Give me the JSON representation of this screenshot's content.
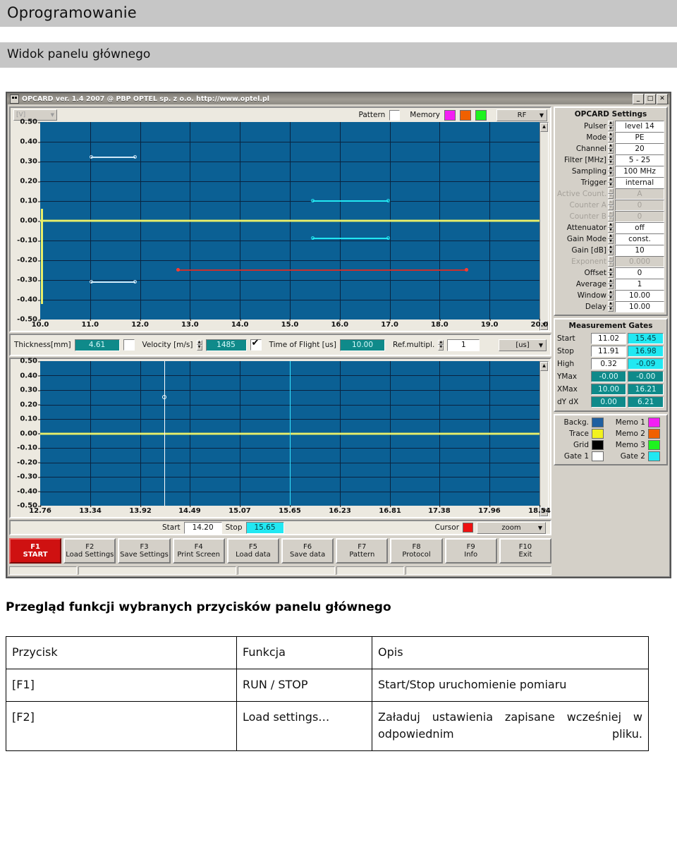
{
  "document": {
    "title": "Oprogramowanie",
    "section": "Widok panelu głównego",
    "overview_title": "Przegląd funkcji wybranych przycisków panelu głównego"
  },
  "app": {
    "titlebar": {
      "title": "OPCARD ver. 1.4 2007 @ PBP OPTEL sp. z o.o. http://www.optel.pl",
      "minimize": "_",
      "maximize": "□",
      "close": "✕"
    },
    "top_chart_bar": {
      "unit_combo": "[V]",
      "pattern_label": "Pattern",
      "memory_label": "Memory",
      "memory_colors": [
        "#f31ef3",
        "#f06000",
        "#1ef31e"
      ],
      "signal_combo": "RF"
    },
    "measure_bar": {
      "thickness_label": "Thickness[mm]",
      "thickness_value": "4.61",
      "velocity_label": "Velocity [m/s]",
      "velocity_value": "1485",
      "tof_label": "Time of Flight [us]",
      "tof_value": "10.00",
      "refmult_label": "Ref.multipl.",
      "refmult_value": "1",
      "unit_combo": "[us]"
    },
    "cursor_bar": {
      "start_label": "Start",
      "start_value": "14.20",
      "stop_label": "Stop",
      "stop_value": "15.65",
      "cursor_label": "Cursor",
      "cursor_color": "#ee1111",
      "mode_combo": "zoom"
    },
    "settings": {
      "title": "OPCARD Settings",
      "rows": [
        {
          "name": "Pulser",
          "value": "level 14",
          "disabled": false
        },
        {
          "name": "Mode",
          "value": "PE",
          "disabled": false
        },
        {
          "name": "Channel",
          "value": "20",
          "disabled": false
        },
        {
          "name": "Filter [MHz]",
          "value": "5 - 25",
          "disabled": false
        },
        {
          "name": "Sampling",
          "value": "100 MHz",
          "disabled": false
        },
        {
          "name": "Trigger",
          "value": "internal",
          "disabled": false
        },
        {
          "name": "Active Count.",
          "value": "A",
          "disabled": true
        },
        {
          "name": "Counter A",
          "value": "0",
          "disabled": true
        },
        {
          "name": "Counter B",
          "value": "0",
          "disabled": true
        },
        {
          "name": "Attenuator",
          "value": "off",
          "disabled": false
        },
        {
          "name": "Gain Mode",
          "value": "const.",
          "disabled": false
        },
        {
          "name": "Gain [dB]",
          "value": "10",
          "disabled": false
        },
        {
          "name": "Exponent",
          "value": "0.000",
          "disabled": true
        },
        {
          "name": "Offset",
          "value": "0",
          "disabled": false
        },
        {
          "name": "Average",
          "value": "1",
          "disabled": false
        },
        {
          "name": "Window",
          "value": "10.00",
          "disabled": false
        },
        {
          "name": "Delay",
          "value": "10.00",
          "disabled": false
        }
      ]
    },
    "gates": {
      "title": "Measurement Gates",
      "rows": [
        {
          "name": "Start",
          "a": "11.02",
          "b": "15.45",
          "a_style": "gw",
          "b_style": "gc"
        },
        {
          "name": "Stop",
          "a": "11.91",
          "b": "16.98",
          "a_style": "gw",
          "b_style": "gc"
        },
        {
          "name": "High",
          "a": "0.32",
          "b": "-0.09",
          "a_style": "gw",
          "b_style": "gc"
        },
        {
          "name": "YMax",
          "a": "-0.00",
          "b": "-0.00",
          "a_style": "gt",
          "b_style": "gt"
        },
        {
          "name": "XMax",
          "a": "10.00",
          "b": "16.21",
          "a_style": "gt",
          "b_style": "gt"
        },
        {
          "name": "dY dX",
          "a": "0.00",
          "b": "6.21",
          "a_style": "gt",
          "b_style": "gt"
        }
      ]
    },
    "legend": {
      "left": [
        {
          "name": "Backg.",
          "color": "#1f5fa0"
        },
        {
          "name": "Trace",
          "color": "#f2f21e"
        },
        {
          "name": "Grid",
          "color": "#000000"
        },
        {
          "name": "Gate 1",
          "color": "#ffffff"
        }
      ],
      "right": [
        {
          "name": "Memo 1",
          "color": "#f31ef3"
        },
        {
          "name": "Memo 2",
          "color": "#f06000"
        },
        {
          "name": "Memo 3",
          "color": "#1ef31e"
        },
        {
          "name": "Gate 2",
          "color": "#22e8f2"
        }
      ]
    },
    "fkeys": [
      {
        "key": "F1",
        "label": "START",
        "accent": "#cf1111"
      },
      {
        "key": "F2",
        "label": "Load Settings",
        "accent": ""
      },
      {
        "key": "F3",
        "label": "Save Settings",
        "accent": ""
      },
      {
        "key": "F4",
        "label": "Print Screen",
        "accent": ""
      },
      {
        "key": "F5",
        "label": "Load data",
        "accent": ""
      },
      {
        "key": "F6",
        "label": "Save data",
        "accent": ""
      },
      {
        "key": "F7",
        "label": "Pattern",
        "accent": ""
      },
      {
        "key": "F8",
        "label": "Protocol",
        "accent": ""
      },
      {
        "key": "F9",
        "label": "Info",
        "accent": ""
      },
      {
        "key": "F10",
        "label": "Exit",
        "accent": ""
      }
    ]
  },
  "chart_data": [
    {
      "type": "line",
      "name": "top-waveform",
      "title": "",
      "xlabel": "",
      "ylabel": "[V]",
      "xlim": [
        10.0,
        20.0
      ],
      "ylim": [
        -0.5,
        0.5
      ],
      "xticks": [
        "10.0",
        "11.0",
        "12.0",
        "13.0",
        "14.0",
        "15.0",
        "16.0",
        "17.0",
        "18.0",
        "19.0",
        "20.0"
      ],
      "yticks": [
        "0.50",
        "0.40",
        "0.30",
        "0.20",
        "0.10",
        "0.00",
        "-0.10",
        "-0.20",
        "-0.30",
        "-0.40",
        "-0.50"
      ],
      "grid": true,
      "background": "#0b6094",
      "series": [
        {
          "name": "Trace",
          "color": "#e9ef6a",
          "level": 0.0,
          "note": "flat noisy RF trace at ~0.00 V with a large burst at x=10.0 spanning -0.42..0.06"
        },
        {
          "name": "Gate 1 high",
          "color": "#cfe8f7",
          "y": 0.32,
          "x0": 11.02,
          "x1": 11.91
        },
        {
          "name": "Gate 1 low",
          "color": "#cfe8f7",
          "y": -0.31,
          "x0": 11.02,
          "x1": 11.91
        },
        {
          "name": "Gate 2 high",
          "color": "#22e8f2",
          "y": 0.1,
          "x0": 15.45,
          "x1": 16.98
        },
        {
          "name": "Gate 2 low",
          "color": "#22e8f2",
          "y": -0.09,
          "x0": 15.45,
          "x1": 16.98
        },
        {
          "name": "Reference",
          "color": "#c9312f",
          "y": -0.25,
          "x0": 12.75,
          "x1": 18.55
        }
      ]
    },
    {
      "type": "line",
      "name": "bottom-waveform-zoom",
      "title": "",
      "xlabel": "",
      "ylabel": "",
      "xlim": [
        12.76,
        18.54
      ],
      "ylim": [
        -0.5,
        0.5
      ],
      "xticks": [
        "12.76",
        "13.34",
        "13.92",
        "14.49",
        "15.07",
        "15.65",
        "16.23",
        "16.81",
        "17.38",
        "17.96",
        "18.54"
      ],
      "yticks": [
        "0.50",
        "0.40",
        "0.30",
        "0.20",
        "0.10",
        "0.00",
        "-0.10",
        "-0.20",
        "-0.30",
        "-0.40",
        "-0.50"
      ],
      "grid": true,
      "background": "#0b6094",
      "series": [
        {
          "name": "Trace",
          "color": "#e9ef6a",
          "level": 0.0,
          "note": "flat noisy RF trace at ~0.00 V"
        },
        {
          "name": "Cursor Start",
          "color": "#ffffff",
          "x": 14.2
        },
        {
          "name": "Cursor Stop",
          "color": "#22e8f2",
          "x": 15.65
        },
        {
          "name": "Marker",
          "color": "#ffffff",
          "x": 14.2,
          "y": 0.25
        }
      ]
    }
  ],
  "table": {
    "headers": [
      "Przycisk",
      "Funkcja",
      "Opis"
    ],
    "rows": [
      {
        "key": "[F1]",
        "fn": "RUN / STOP",
        "desc": "Start/Stop uruchomienie pomiaru",
        "justify": false
      },
      {
        "key": "[F2]",
        "fn": "Load settings…",
        "desc": "Załaduj ustawienia zapisane wcześniej w odpowiednim pliku.",
        "justify": true
      }
    ]
  }
}
